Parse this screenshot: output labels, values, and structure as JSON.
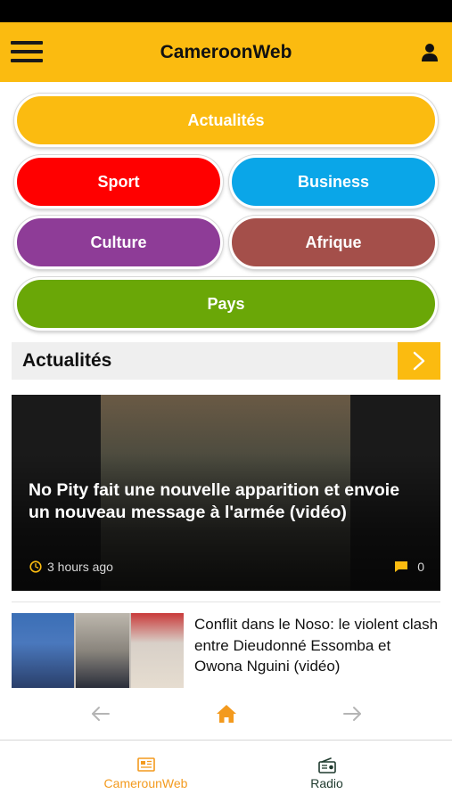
{
  "header": {
    "title": "CameroonWeb",
    "menu_icon": "hamburger-menu-icon",
    "user_icon": "user-icon",
    "background": "#fbbb10"
  },
  "categories": [
    {
      "label": "Actualités",
      "color": "#fbbb10"
    },
    {
      "label": "Sport",
      "color": "#ff0000"
    },
    {
      "label": "Business",
      "color": "#0aa6e8"
    },
    {
      "label": "Culture",
      "color": "#8e3c97"
    },
    {
      "label": "Afrique",
      "color": "#a44f4a"
    },
    {
      "label": "Pays",
      "color": "#6aa707"
    }
  ],
  "section": {
    "title": "Actualités",
    "arrow_icon": "chevron-right-icon"
  },
  "featured": {
    "title": "No Pity fait une nouvelle apparition et envoie un nouveau message à l'armée (vidéo)",
    "time": "3 hours ago",
    "comments": "0",
    "accent_color": "#fbbb10"
  },
  "article": {
    "title": "Conflit dans le Noso: le violent clash entre Dieudonné Essomba et Owona Nguini (vidéo)"
  },
  "nav": {
    "back_icon": "arrow-left-icon",
    "home_icon": "home-icon",
    "forward_icon": "arrow-right-icon",
    "home_color": "#f39a1e"
  },
  "tabs": [
    {
      "label": "CamerounWeb",
      "icon": "newspaper-icon",
      "color": "#f39a1e",
      "active": true
    },
    {
      "label": "Radio",
      "icon": "radio-icon",
      "color": "#1f3a2e",
      "active": false
    }
  ]
}
